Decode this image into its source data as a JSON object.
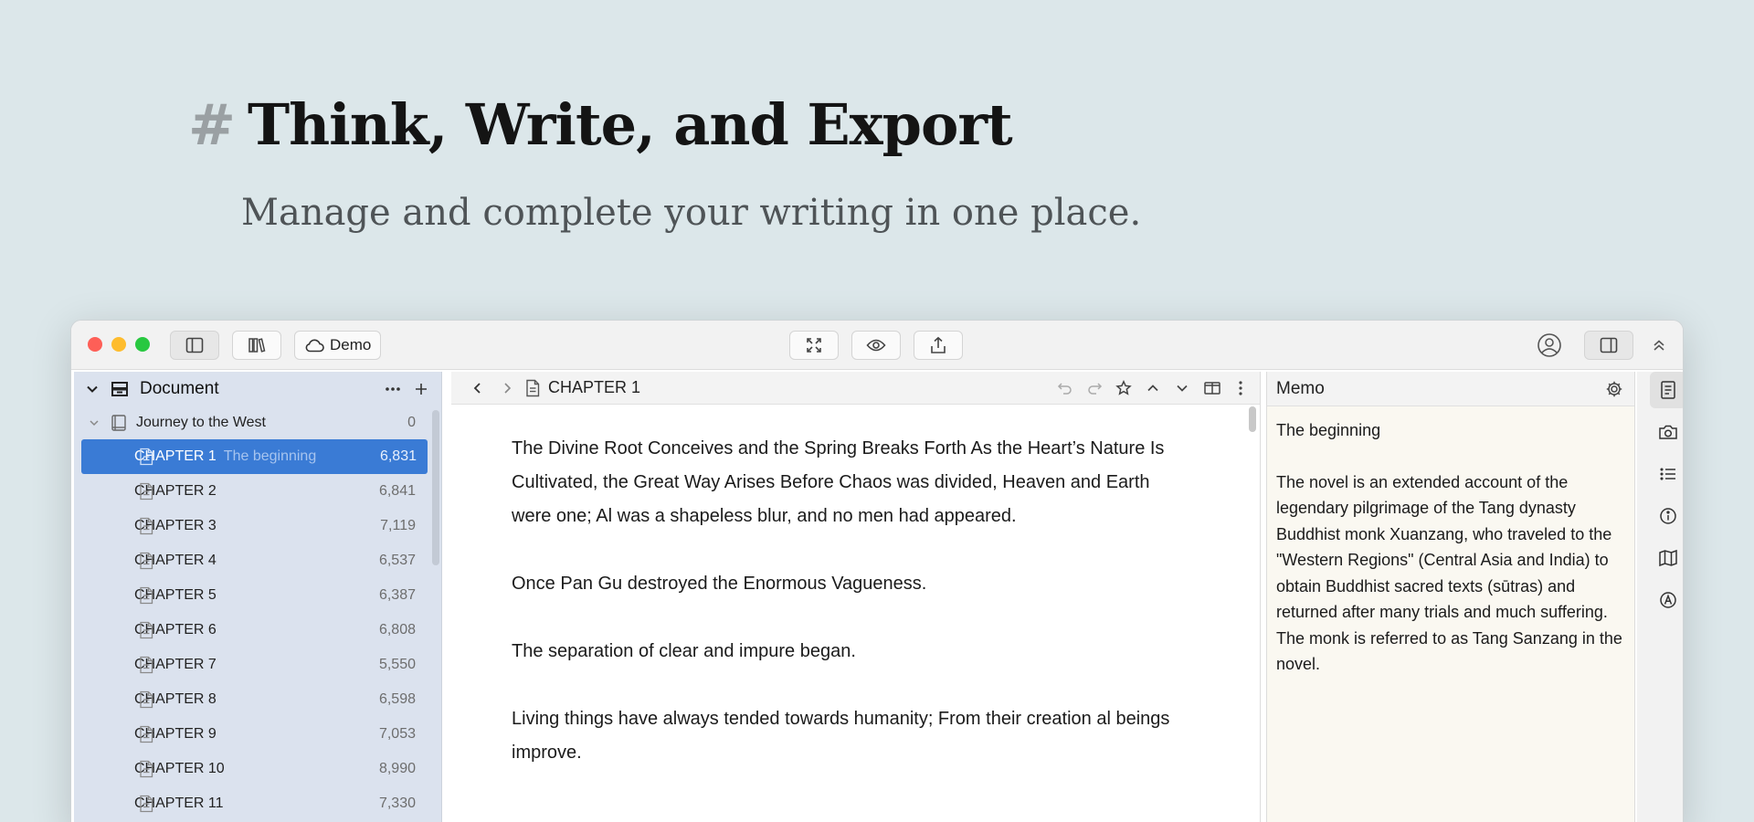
{
  "hero": {
    "hash": "#",
    "title": "Think, Write, and Export",
    "subtitle": "Manage and complete your writing in one place."
  },
  "titlebar": {
    "traffic_lights": {
      "close": "#fe5f57",
      "minimize": "#febc2e",
      "zoom": "#28c840"
    },
    "demo_label": "Demo"
  },
  "sidebar": {
    "header_label": "Document",
    "book": {
      "title": "Journey to the West",
      "count": "0"
    },
    "chapters": [
      {
        "title": "CHAPTER 1",
        "subtitle": "The beginning",
        "words": "6,831"
      },
      {
        "title": "CHAPTER 2",
        "subtitle": "",
        "words": "6,841"
      },
      {
        "title": "CHAPTER 3",
        "subtitle": "",
        "words": "7,119"
      },
      {
        "title": "CHAPTER 4",
        "subtitle": "",
        "words": "6,537"
      },
      {
        "title": "CHAPTER 5",
        "subtitle": "",
        "words": "6,387"
      },
      {
        "title": "CHAPTER 6",
        "subtitle": "",
        "words": "6,808"
      },
      {
        "title": "CHAPTER 7",
        "subtitle": "",
        "words": "5,550"
      },
      {
        "title": "CHAPTER 8",
        "subtitle": "",
        "words": "6,598"
      },
      {
        "title": "CHAPTER 9",
        "subtitle": "",
        "words": "7,053"
      },
      {
        "title": "CHAPTER 10",
        "subtitle": "",
        "words": "8,990"
      },
      {
        "title": "CHAPTER 11",
        "subtitle": "",
        "words": "7,330"
      }
    ],
    "accent": "#3a7bd5"
  },
  "editor": {
    "title": "CHAPTER 1",
    "paragraphs": [
      "The Divine Root Conceives and the Spring Breaks Forth As the Heart’s Nature Is Cultivated, the Great Way Arises Before Chaos was divided, Heaven and Earth were one; Al was a shapeless blur, and no men had appeared.",
      "Once Pan Gu destroyed the Enormous Vagueness.",
      "The separation of clear and impure began.",
      "Living things have always tended towards humanity; From their creation al beings improve."
    ]
  },
  "memo": {
    "title": "Memo",
    "heading": "The beginning",
    "body": "The novel is an extended account of the legendary pilgrimage of the Tang dynasty Buddhist monk Xuanzang, who traveled to the \"Western Regions\" (Central Asia and India) to obtain Buddhist sacred texts (sūtras) and returned after many trials and much suffering. The monk is referred to as Tang Sanzang in the novel."
  },
  "icons": {
    "sidebar_toggle": "sidebar-left-icon",
    "library": "library-icon",
    "cloud": "cloud-icon",
    "fullscreen": "expand-icon",
    "preview": "eye-icon",
    "export": "share-icon",
    "account": "user-circle-icon",
    "right_panel": "sidebar-right-icon",
    "collapse": "chevron-double-up-icon"
  }
}
